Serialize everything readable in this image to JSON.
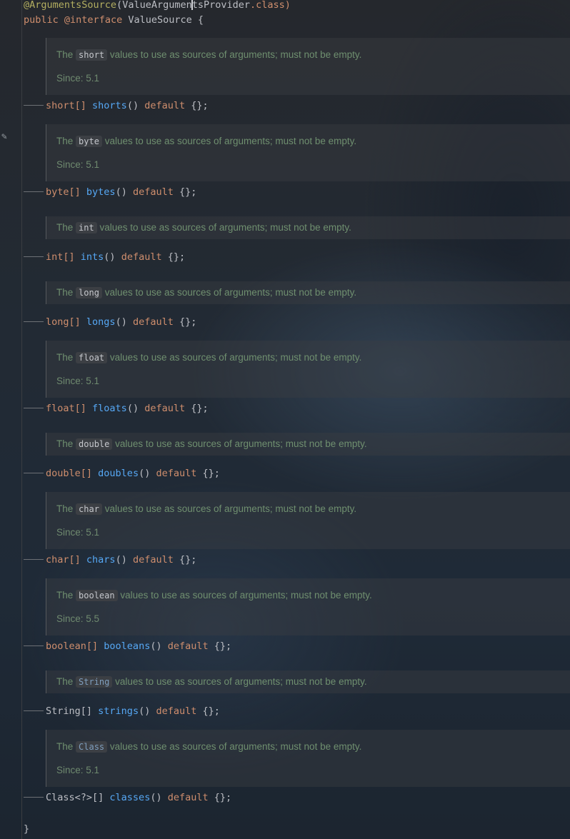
{
  "editor": {
    "annotation_line": {
      "name": "@ArgumentsSource",
      "arg_before_caret": "ValueArgumen",
      "arg_after_caret": "tsProvider",
      "suffix": ".class)"
    },
    "header": {
      "kw_public": "public",
      "kw_interface": "@interface",
      "name": "ValueSource",
      "brace": "{"
    },
    "doc_prefix": "The",
    "doc_suffix": "values to use as sources of arguments; must not be empty.",
    "members": [
      {
        "type": "short",
        "code": "short",
        "return_type": "short[]",
        "method": "shorts",
        "since": "Since: 5.1"
      },
      {
        "type": "byte",
        "code": "byte",
        "return_type": "byte[]",
        "method": "bytes",
        "since": "Since: 5.1"
      },
      {
        "type": "int",
        "code": "int",
        "return_type": "int[]",
        "method": "ints",
        "since": ""
      },
      {
        "type": "long",
        "code": "long",
        "return_type": "long[]",
        "method": "longs",
        "since": ""
      },
      {
        "type": "float",
        "code": "float",
        "return_type": "float[]",
        "method": "floats",
        "since": "Since: 5.1"
      },
      {
        "type": "double",
        "code": "double",
        "return_type": "double[]",
        "method": "doubles",
        "since": ""
      },
      {
        "type": "char",
        "code": "char",
        "return_type": "char[]",
        "method": "chars",
        "since": "Since: 5.1"
      },
      {
        "type": "boolean",
        "code": "boolean",
        "return_type": "boolean[]",
        "method": "booleans",
        "since": "Since: 5.5"
      },
      {
        "type": "String",
        "code": "String",
        "return_type": "String[]",
        "method": "strings",
        "since": ""
      },
      {
        "type": "Class",
        "code": "Class",
        "return_type": "Class<?>[]",
        "method": "classes",
        "since": "Since: 5.1"
      }
    ],
    "default_kw": "default",
    "default_val": "{};",
    "call_parens": "()",
    "closing_brace": "}"
  }
}
